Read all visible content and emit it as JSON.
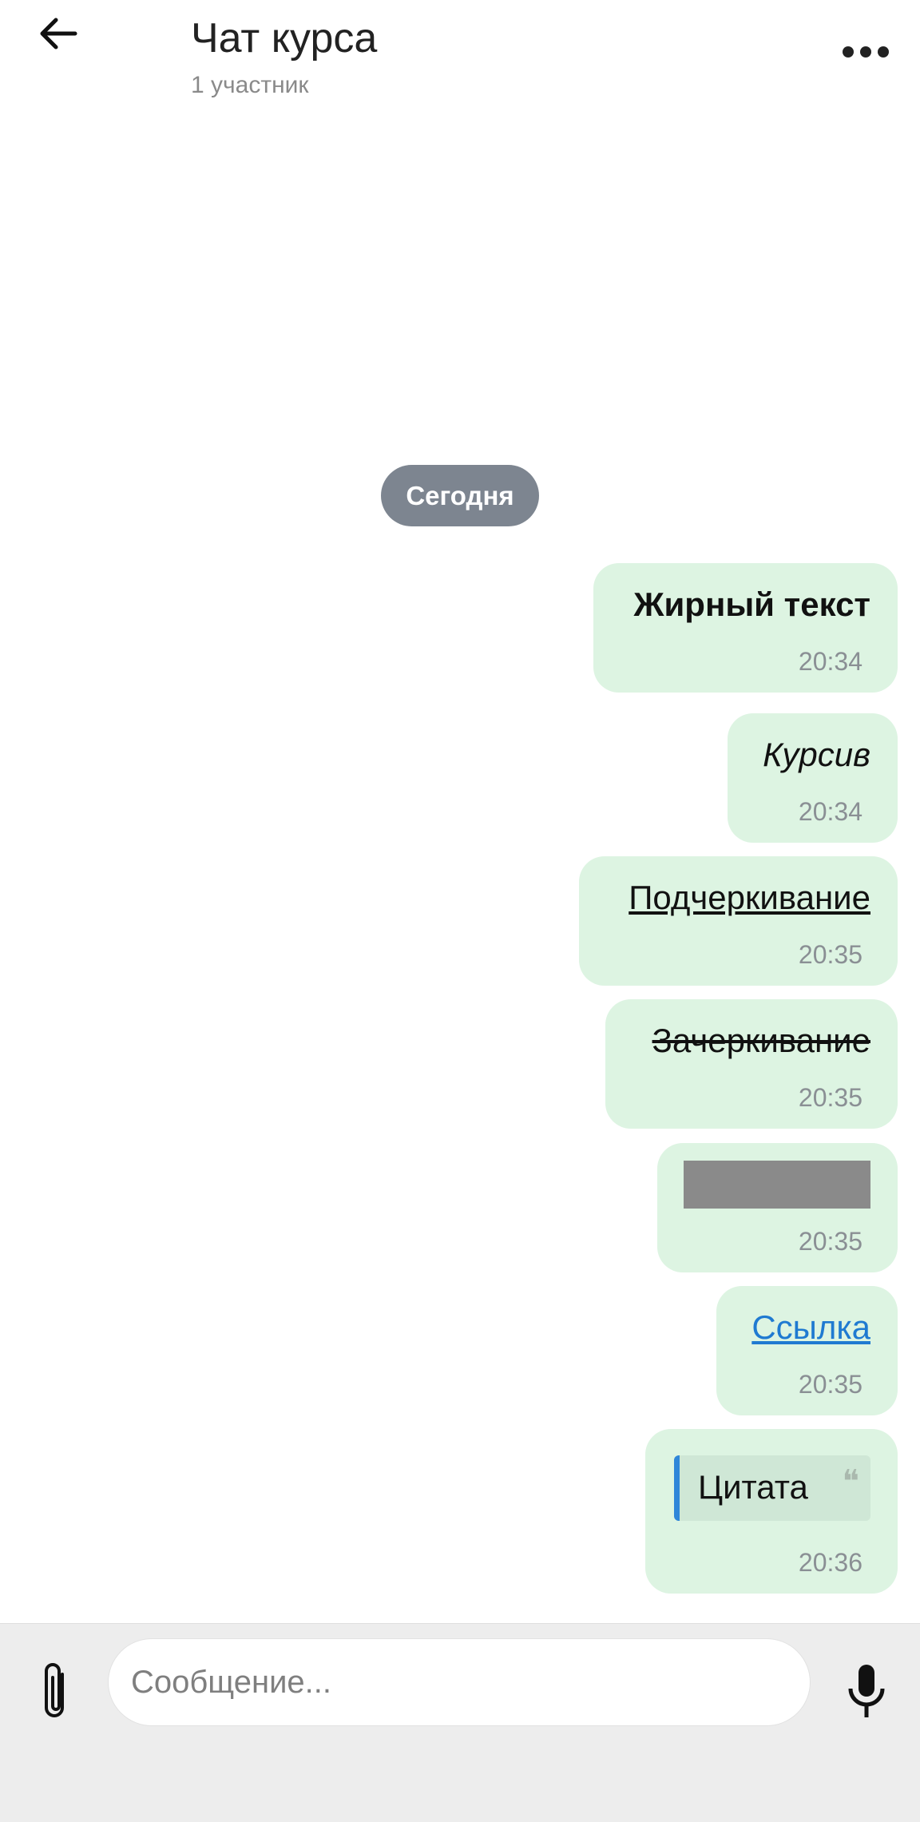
{
  "header": {
    "title": "Чат курса",
    "subtitle": "1 участник",
    "back_icon": "arrow-left-icon",
    "more_icon": "more-horizontal-icon"
  },
  "date_separator": "Сегодня",
  "messages": [
    {
      "text": "Жирный текст",
      "time": "20:34",
      "style": "bold"
    },
    {
      "text": "Курсив",
      "time": "20:34",
      "style": "italic"
    },
    {
      "text": "Подчеркивание",
      "time": "20:35",
      "style": "underline"
    },
    {
      "text": "Зачеркивание",
      "time": "20:35",
      "style": "strikethrough"
    },
    {
      "text": "",
      "time": "20:35",
      "style": "spoiler"
    },
    {
      "text": "Ссылка",
      "time": "20:35",
      "style": "link"
    },
    {
      "text": "Цитата",
      "time": "20:36",
      "style": "quote",
      "icon": "quote-icon"
    }
  ],
  "composer": {
    "placeholder": "Сообщение...",
    "attach_icon": "paperclip-icon",
    "mic_icon": "microphone-icon"
  },
  "colors": {
    "bubble_bg": "#ddf4e2",
    "date_pill_bg": "#7d8590",
    "link": "#1f7ad1",
    "quote_bar": "#2f86d9",
    "spoiler": "#8a8a8a",
    "input_bar_bg": "#ededed"
  }
}
